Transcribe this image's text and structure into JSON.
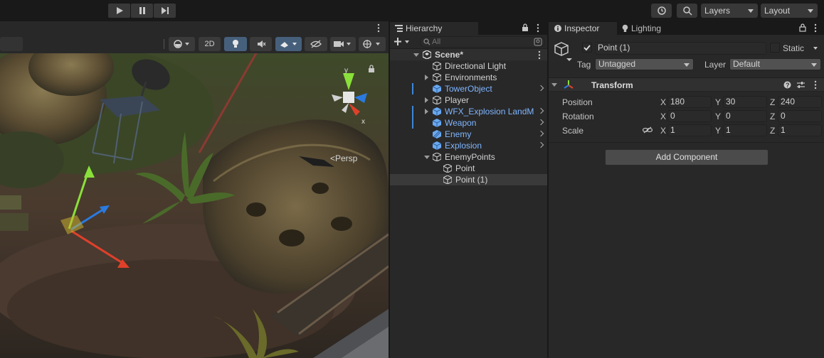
{
  "toolbar": {
    "layers_label": "Layers",
    "layout_label": "Layout"
  },
  "scene_view": {
    "tool_2d_label": "2D",
    "persp_label": "<Persp",
    "gizmo_axes": {
      "x": "x",
      "y": "y"
    }
  },
  "hierarchy": {
    "tab_label": "Hierarchy",
    "search_placeholder": "All",
    "scene_name": "Scene*",
    "items": [
      {
        "label": "Directional Light",
        "prefab": false,
        "fold": "none",
        "depth": 1
      },
      {
        "label": "Environments",
        "prefab": false,
        "fold": "closed",
        "depth": 1
      },
      {
        "label": "TowerObject",
        "prefab": true,
        "fold": "none",
        "depth": 1
      },
      {
        "label": "Player",
        "prefab": false,
        "fold": "closed",
        "depth": 1
      },
      {
        "label": "WFX_Explosion LandM",
        "prefab": true,
        "fold": "closed",
        "depth": 1
      },
      {
        "label": "Weapon",
        "prefab": true,
        "fold": "none",
        "depth": 1
      },
      {
        "label": "Enemy",
        "prefab": true,
        "fold": "none",
        "depth": 1
      },
      {
        "label": "Explosion",
        "prefab": true,
        "fold": "none",
        "depth": 1
      },
      {
        "label": "EnemyPoints",
        "prefab": false,
        "fold": "open",
        "depth": 1
      },
      {
        "label": "Point",
        "prefab": false,
        "fold": "none",
        "depth": 2
      },
      {
        "label": "Point (1)",
        "prefab": false,
        "fold": "none",
        "depth": 2
      }
    ]
  },
  "inspector": {
    "tab_label": "Inspector",
    "lighting_tab_label": "Lighting",
    "object_name": "Point (1)",
    "active": true,
    "static_label": "Static",
    "tag_label": "Tag",
    "tag_value": "Untagged",
    "layer_label": "Layer",
    "layer_value": "Default",
    "component_title": "Transform",
    "position_label": "Position",
    "rotation_label": "Rotation",
    "scale_label": "Scale",
    "position": {
      "x": "180",
      "y": "30",
      "z": "240"
    },
    "rotation": {
      "x": "0",
      "y": "0",
      "z": "0"
    },
    "scale": {
      "x": "1",
      "y": "1",
      "z": "1"
    },
    "axis_x": "X",
    "axis_y": "Y",
    "axis_z": "Z",
    "add_component_label": "Add Component"
  },
  "colors": {
    "prefab_text": "#7fb5ff",
    "selection_bg": "#3a3a3a",
    "accent_blue": "#3d86d6"
  }
}
